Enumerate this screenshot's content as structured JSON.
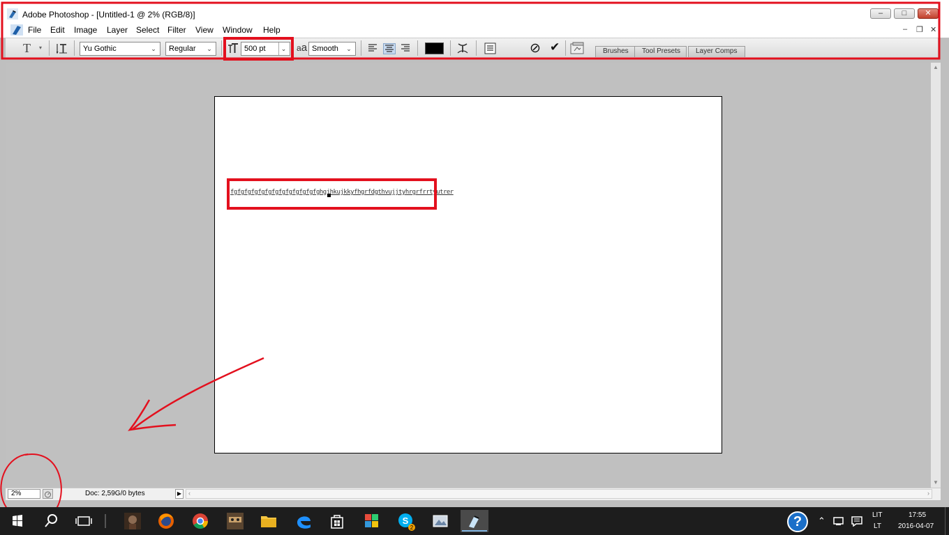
{
  "window": {
    "title": "Adobe Photoshop - [Untitled-1 @ 2% (RGB/8)]",
    "minimize_symbol": "–",
    "restore_symbol": "□",
    "close_symbol": "✕"
  },
  "menu": {
    "items": [
      "File",
      "Edit",
      "Image",
      "Layer",
      "Select",
      "Filter",
      "View",
      "Window",
      "Help"
    ],
    "doc_minimize": "–",
    "doc_restore": "❐",
    "doc_close": "✕"
  },
  "options": {
    "tool_glyph": "T",
    "font_family": "Yu Gothic",
    "font_style": "Regular",
    "font_size": "500 pt",
    "antialias_label": "a",
    "antialias_sub": "a",
    "antialias": "Smooth",
    "text_color": "#000000",
    "align_active": "center",
    "cancel_symbol": "⊘",
    "commit_symbol": "✔"
  },
  "panel_tabs": [
    "Brushes",
    "Tool Presets",
    "Layer Comps"
  ],
  "document": {
    "text_content": "fgfgfgfgfgfgfgfgfgfgfgfgfghgjhkujkkyfhgrfdgthvujjtyhrgrfrrtyutrer"
  },
  "status": {
    "zoom": "2%",
    "doc_info": "Doc: 2,59G/0 bytes",
    "arrow_symbol": "▶"
  },
  "taskbar": {
    "language_top": "LIT",
    "language_bottom": "LT",
    "time": "17:55",
    "date": "2016-04-07",
    "help_glyph": "?",
    "skype_badge": "2"
  },
  "colors": {
    "annotation_red": "#e3101e",
    "workspace_gray": "#c0c0c0",
    "taskbar_bg": "#1d1d1d"
  }
}
